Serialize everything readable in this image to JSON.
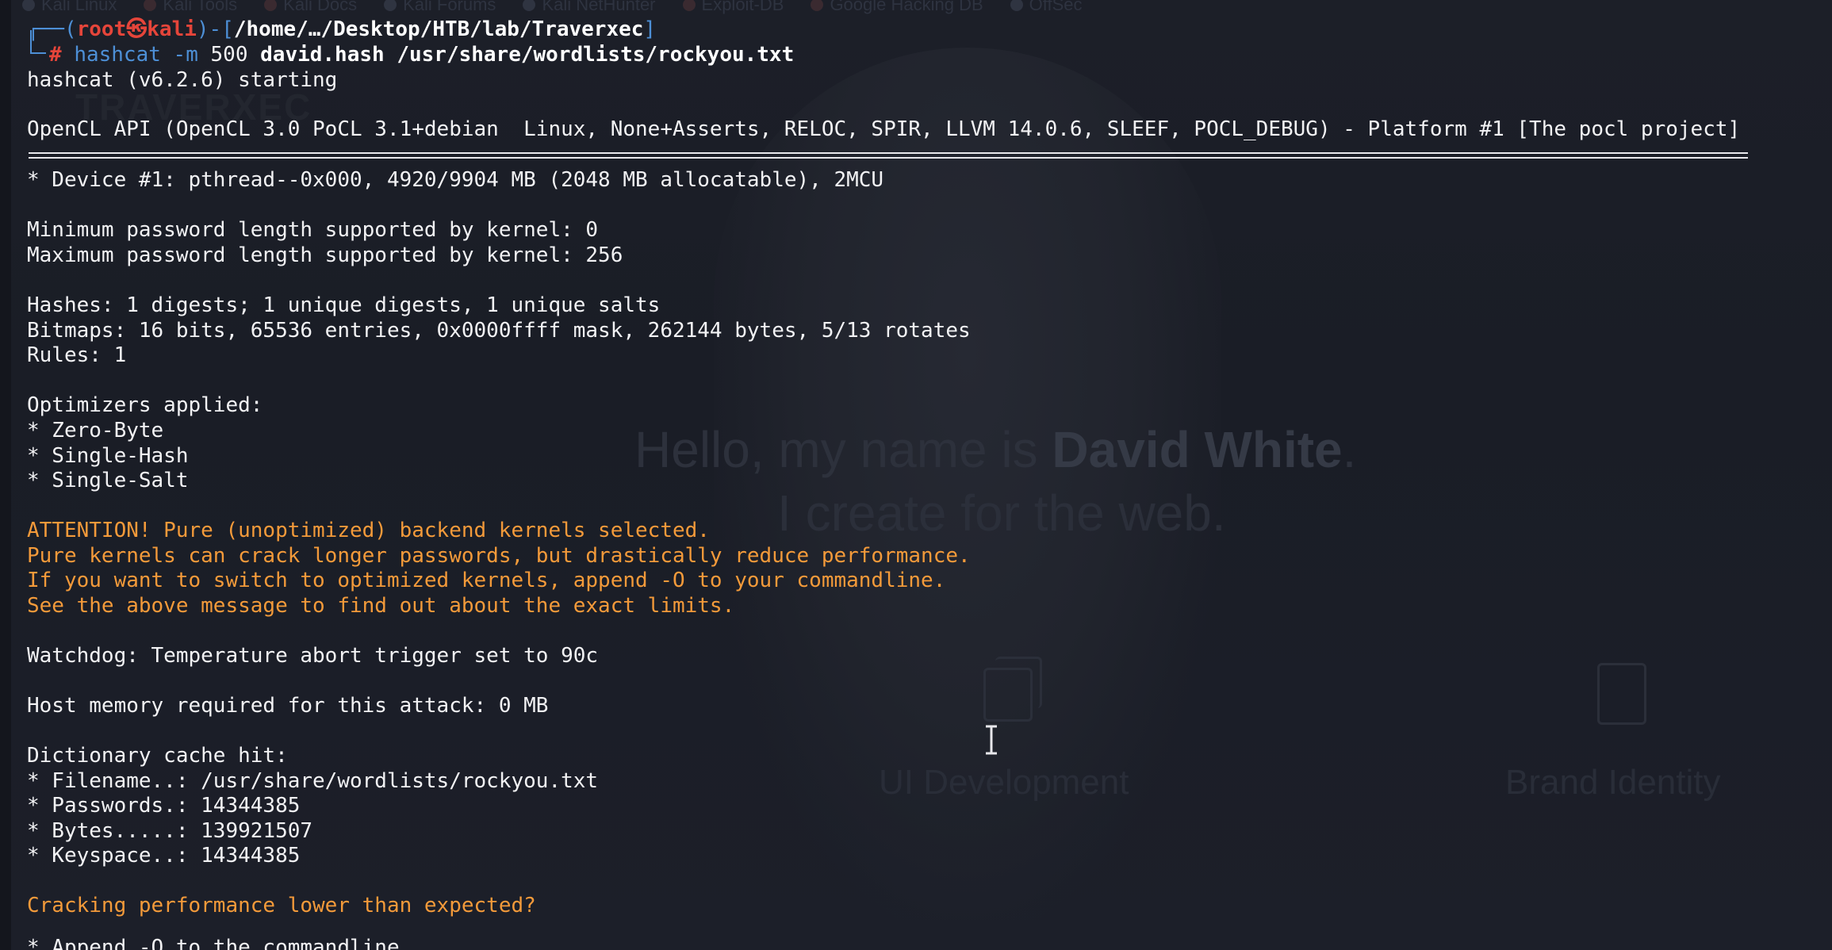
{
  "background_site": {
    "bookmarks": [
      "Kali Linux",
      "Kali Tools",
      "Kali Docs",
      "Kali Forums",
      "Kali NetHunter",
      "Exploit-DB",
      "Google Hacking DB",
      "OffSec"
    ],
    "brand": "TRAVERXEC",
    "hello_prefix": "Hello, my name is ",
    "hello_name": "David White",
    "hello_suffix": ".",
    "tagline": "I create for the web.",
    "card1_title": "UI Development",
    "card2_title": "Brand Identity"
  },
  "prompt": {
    "open": "┌──(",
    "user": "root",
    "at": "㉿",
    "host": "kali",
    "sep": ")-[",
    "path": "/home/…/Desktop/HTB/lab/Traverxec",
    "close": "]",
    "hash": "#",
    "cmd": "hashcat",
    "flag": "-m",
    "mode": "500",
    "args": "david.hash /usr/share/wordlists/rockyou.txt"
  },
  "output": {
    "l01": "hashcat (v6.2.6) starting",
    "l02": "OpenCL API (OpenCL 3.0 PoCL 3.1+debian  Linux, None+Asserts, RELOC, SPIR, LLVM 14.0.6, SLEEF, POCL_DEBUG) - Platform #1 [The pocl project]",
    "l03": "* Device #1: pthread--0x000, 4920/9904 MB (2048 MB allocatable), 2MCU",
    "l04": "Minimum password length supported by kernel: 0",
    "l05": "Maximum password length supported by kernel: 256",
    "l06": "Hashes: 1 digests; 1 unique digests, 1 unique salts",
    "l07": "Bitmaps: 16 bits, 65536 entries, 0x0000ffff mask, 262144 bytes, 5/13 rotates",
    "l08": "Rules: 1",
    "l09": "Optimizers applied:",
    "l10": "* Zero-Byte",
    "l11": "* Single-Hash",
    "l12": "* Single-Salt",
    "l13": "ATTENTION! Pure (unoptimized) backend kernels selected.",
    "l14": "Pure kernels can crack longer passwords, but drastically reduce performance.",
    "l15": "If you want to switch to optimized kernels, append -O to your commandline.",
    "l16": "See the above message to find out about the exact limits.",
    "l17": "Watchdog: Temperature abort trigger set to 90c",
    "l18": "Host memory required for this attack: 0 MB",
    "l19": "Dictionary cache hit:",
    "l20": "* Filename..: /usr/share/wordlists/rockyou.txt",
    "l21": "* Passwords.: 14344385",
    "l22": "* Bytes.....: 139921507",
    "l23": "* Keyspace..: 14344385",
    "l24": "Cracking performance lower than expected?",
    "l25": "* Append -O to the commandline."
  },
  "colors": {
    "prompt_blue": "#4d8fd6",
    "prompt_red": "#e5453a",
    "warning_orange": "#f39a3a",
    "text": "#f2f2f4",
    "background": "#1c1f28"
  }
}
